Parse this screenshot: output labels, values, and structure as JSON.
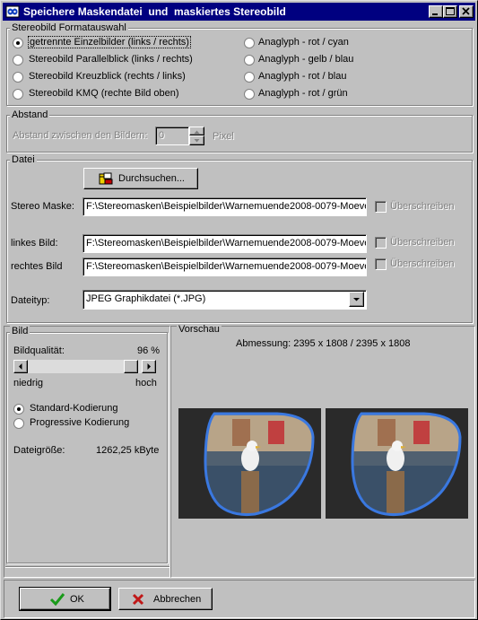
{
  "window": {
    "title": "Speichere Maskendatei  und  maskiertes Stereobild",
    "buttons": [
      "minimize-icon",
      "maximize-icon",
      "close-icon"
    ]
  },
  "format": {
    "group_label": "Stereobild Formatauswahl",
    "options_left": [
      {
        "label": "getrennte Einzelbilder (links / rechts)",
        "selected": true
      },
      {
        "label": "Stereobild Parallelblick (links / rechts)",
        "selected": false
      },
      {
        "label": "Stereobild Kreuzblick (rechts / links)",
        "selected": false
      },
      {
        "label": "Stereobild KMQ (rechte Bild  oben)",
        "selected": false
      }
    ],
    "options_right": [
      {
        "label": "Anaglyph - rot / cyan",
        "selected": false
      },
      {
        "label": "Anaglyph - gelb / blau",
        "selected": false
      },
      {
        "label": "Anaglyph - rot / blau",
        "selected": false
      },
      {
        "label": "Anaglyph - rot / grün",
        "selected": false
      }
    ]
  },
  "abstand": {
    "group_label": "Abstand",
    "label": "Abstand zwischen den Bildern:",
    "value": "0",
    "unit": "Pixel"
  },
  "datei": {
    "group_label": "Datei",
    "browse_label": "Durchsuchen...",
    "mask_label": "Stereo Maske:",
    "mask_value": "F:\\Stereomasken\\Beispielbilder\\Warnemuende2008-0079-Moeve",
    "left_label": "linkes Bild:",
    "left_value": "F:\\Stereomasken\\Beispielbilder\\Warnemuende2008-0079-Moeve",
    "right_label": "rechtes Bild",
    "right_value": "F:\\Stereomasken\\Beispielbilder\\Warnemuende2008-0079-Moeve",
    "overwrite_label": "Überschreiben",
    "type_label": "Dateityp:",
    "type_value": "JPEG Graphikdatei (*.JPG)"
  },
  "bild": {
    "group_label": "Bild",
    "quality_label": "Bildqualität:",
    "quality_value": "96 %",
    "quality_fraction": 0.96,
    "low_label": "niedrig",
    "high_label": "hoch",
    "encoding_options": [
      {
        "label": "Standard-Kodierung",
        "selected": true
      },
      {
        "label": "Progressive Kodierung",
        "selected": false
      }
    ],
    "size_label": "Dateigröße:",
    "size_value": "1262,25 kByte"
  },
  "vorschau": {
    "group_label": "Vorschau",
    "dimensions": "Abmessung: 2395 x 1808 /  2395 x 1808"
  },
  "footer": {
    "ok_label": "OK",
    "cancel_label": "Abbrechen"
  },
  "colors": {
    "titlebar": "#000080",
    "face": "#c0c0c0",
    "mask_outline": "#3a78e0",
    "ok_check": "#1a9a1a",
    "cancel_x": "#c01818"
  }
}
